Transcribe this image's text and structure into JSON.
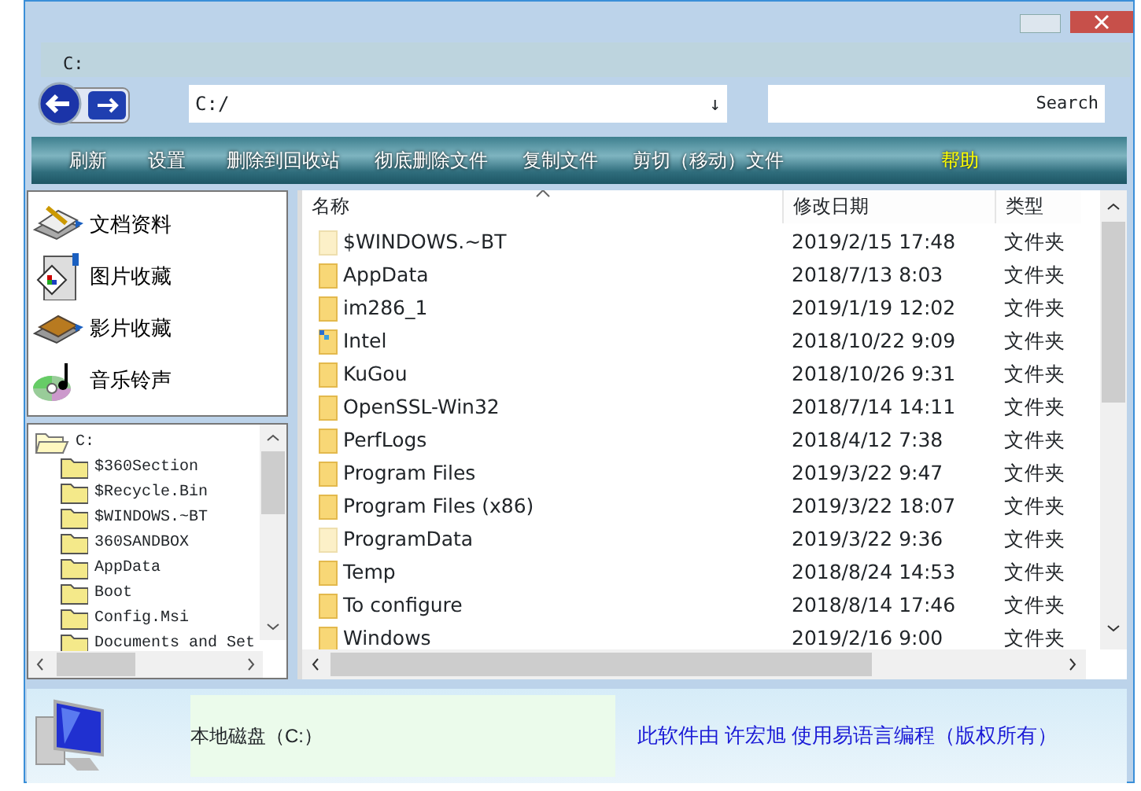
{
  "location": "C:",
  "address": {
    "value": "C:/",
    "dropdown": "↓"
  },
  "search": {
    "value": "Search"
  },
  "toolbar": [
    {
      "label": "刷新",
      "color": "#ffffff"
    },
    {
      "label": "设置",
      "color": "#ffffff"
    },
    {
      "label": "删除到回收站",
      "color": "#ffffff"
    },
    {
      "label": "彻底删除文件",
      "color": "#ffffff"
    },
    {
      "label": "复制文件",
      "color": "#ffffff"
    },
    {
      "label": "剪切（移动）文件",
      "color": "#ffffff"
    },
    {
      "label": "帮助",
      "color": "#ffff00"
    }
  ],
  "categories": [
    {
      "label": "文档资料",
      "kind": "documents"
    },
    {
      "label": "图片收藏",
      "kind": "pictures"
    },
    {
      "label": "影片收藏",
      "kind": "movies"
    },
    {
      "label": "音乐铃声",
      "kind": "music"
    }
  ],
  "tree": {
    "label": "C:",
    "expanded": true,
    "children": [
      {
        "label": "$360Section"
      },
      {
        "label": "$Recycle.Bin"
      },
      {
        "label": "$WINDOWS.~BT"
      },
      {
        "label": "360SANDBOX"
      },
      {
        "label": "AppData"
      },
      {
        "label": "Boot"
      },
      {
        "label": "Config.Msi"
      },
      {
        "label": "Documents and Set"
      }
    ]
  },
  "table": {
    "columns": [
      {
        "label": "名称",
        "sorted": true
      },
      {
        "label": "修改日期",
        "sorted": false
      },
      {
        "label": "类型",
        "sorted": false
      }
    ],
    "rows": [
      {
        "name": "$WINDOWS.~BT",
        "date": "2019/2/15 17:48",
        "type": "文件夹",
        "kind": "hidden"
      },
      {
        "name": "AppData",
        "date": "2018/7/13 8:03",
        "type": "文件夹",
        "kind": "folder"
      },
      {
        "name": "im286_1",
        "date": "2019/1/19 12:02",
        "type": "文件夹",
        "kind": "folder"
      },
      {
        "name": "Intel",
        "date": "2018/10/22 9:09",
        "type": "文件夹",
        "kind": "special"
      },
      {
        "name": "KuGou",
        "date": "2018/10/26 9:31",
        "type": "文件夹",
        "kind": "folder"
      },
      {
        "name": "OpenSSL-Win32",
        "date": "2018/7/14 14:11",
        "type": "文件夹",
        "kind": "folder"
      },
      {
        "name": "PerfLogs",
        "date": "2018/4/12 7:38",
        "type": "文件夹",
        "kind": "folder"
      },
      {
        "name": "Program Files",
        "date": "2019/3/22 9:47",
        "type": "文件夹",
        "kind": "folder"
      },
      {
        "name": "Program Files (x86)",
        "date": "2019/3/22 18:07",
        "type": "文件夹",
        "kind": "folder"
      },
      {
        "name": "ProgramData",
        "date": "2019/3/22 9:36",
        "type": "文件夹",
        "kind": "hidden"
      },
      {
        "name": "Temp",
        "date": "2018/8/24 14:53",
        "type": "文件夹",
        "kind": "folder"
      },
      {
        "name": "To configure",
        "date": "2018/8/14 17:46",
        "type": "文件夹",
        "kind": "folder"
      },
      {
        "name": "Windows",
        "date": "2019/2/16 9:00",
        "type": "文件夹",
        "kind": "folder"
      }
    ]
  },
  "status": {
    "drive": "本地磁盘（C:）",
    "credit": "此软件由 许宏旭 使用易语言编程（版权所有）"
  }
}
